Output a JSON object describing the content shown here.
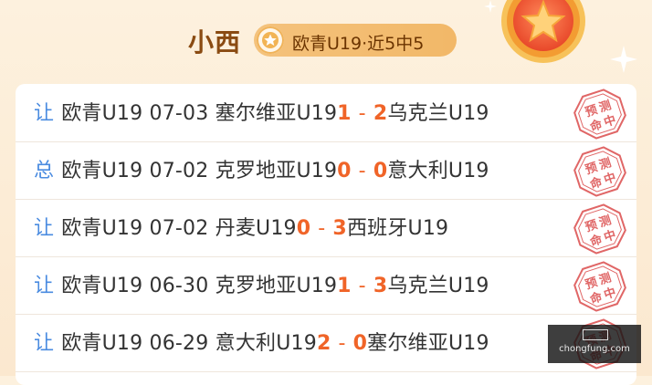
{
  "header": {
    "expert_name": "小西",
    "record_text": "欧青U19·近5中5",
    "badge_icon": "star-icon",
    "medal_icon": "medal-star-icon"
  },
  "colors": {
    "tag_blue": "#4a8be0",
    "score_orange": "#f06428",
    "stamp_red": "#e06666",
    "name_brown": "#8a4b12"
  },
  "stamp_text": [
    "预",
    "测",
    "命",
    "中"
  ],
  "predictions": [
    {
      "tag": "让",
      "league": "欧青U19",
      "date": "07-03",
      "home": "塞尔维亚U19",
      "home_score": "1",
      "away_score": "2",
      "away": "乌克兰U19"
    },
    {
      "tag": "总",
      "league": "欧青U19",
      "date": "07-02",
      "home": "克罗地亚U19",
      "home_score": "0",
      "away_score": "0",
      "away": "意大利U19"
    },
    {
      "tag": "让",
      "league": "欧青U19",
      "date": "07-02",
      "home": "丹麦U19",
      "home_score": "0",
      "away_score": "3",
      "away": "西班牙U19"
    },
    {
      "tag": "让",
      "league": "欧青U19",
      "date": "06-30",
      "home": "克罗地亚U19",
      "home_score": "1",
      "away_score": "3",
      "away": "乌克兰U19"
    },
    {
      "tag": "让",
      "league": "欧青U19",
      "date": "06-29",
      "home": "意大利U19",
      "home_score": "2",
      "away_score": "0",
      "away": "塞尔维亚U19"
    }
  ],
  "score_separator": "-",
  "watermark": {
    "text": "chongfung.com"
  }
}
